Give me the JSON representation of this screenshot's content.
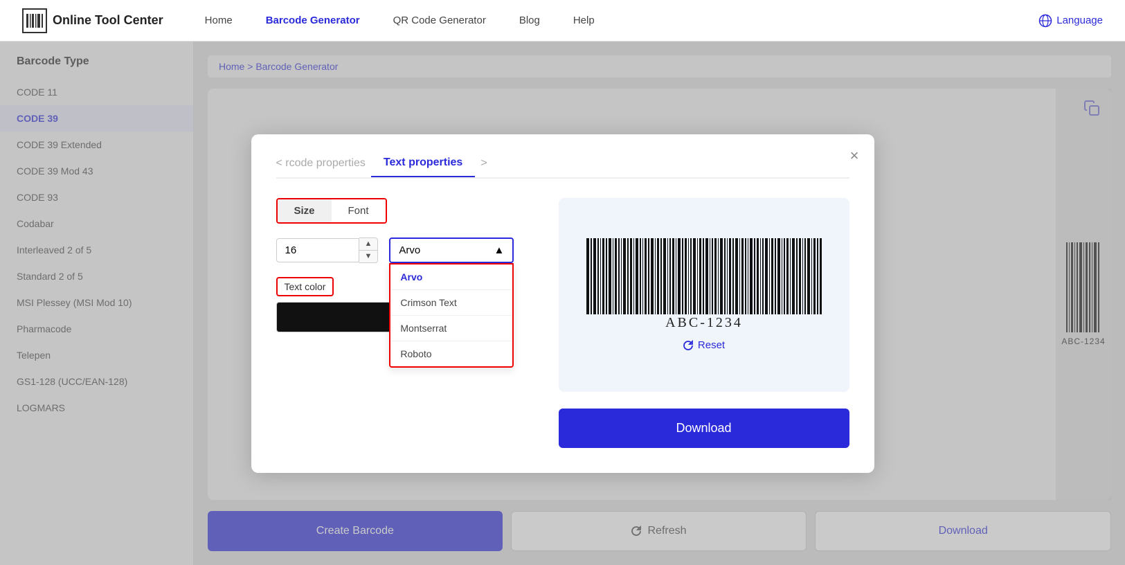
{
  "header": {
    "logo_text": "Online Tool Center",
    "nav": [
      {
        "label": "Home",
        "active": false
      },
      {
        "label": "Barcode Generator",
        "active": true
      },
      {
        "label": "QR Code Generator",
        "active": false
      },
      {
        "label": "Blog",
        "active": false
      },
      {
        "label": "Help",
        "active": false
      }
    ],
    "language_label": "Language"
  },
  "sidebar": {
    "title": "Barcode Type",
    "items": [
      {
        "label": "CODE 11",
        "active": false
      },
      {
        "label": "CODE 39",
        "active": true
      },
      {
        "label": "CODE 39 Extended",
        "active": false
      },
      {
        "label": "CODE 39 Mod 43",
        "active": false
      },
      {
        "label": "CODE 93",
        "active": false
      },
      {
        "label": "Codabar",
        "active": false
      },
      {
        "label": "Interleaved 2 of 5",
        "active": false
      },
      {
        "label": "Standard 2 of 5",
        "active": false
      },
      {
        "label": "MSI Plessey (MSI Mod 10)",
        "active": false
      },
      {
        "label": "Pharmacode",
        "active": false
      },
      {
        "label": "Telepen",
        "active": false
      },
      {
        "label": "GS1-128 (UCC/EAN-128)",
        "active": false
      },
      {
        "label": "LOGMARS",
        "active": false
      }
    ]
  },
  "breadcrumb": {
    "home": "Home",
    "separator": ">",
    "current": "Barcode Generator"
  },
  "bottom_buttons": {
    "create": "Create Barcode",
    "refresh": "Refresh",
    "download": "Download"
  },
  "modal": {
    "tab_prev": "< rcode properties",
    "tab_active": "Text properties",
    "tab_next": ">",
    "form_tabs": [
      "Size",
      "Font"
    ],
    "size_value": "16",
    "font_selected": "Arvo",
    "font_options": [
      "Arvo",
      "Crimson Text",
      "Montserrat",
      "Roboto"
    ],
    "text_color_label": "Text color",
    "color_value": "#111111",
    "barcode_value": "ABC-1234",
    "reset_label": "Reset",
    "download_label": "Download"
  }
}
